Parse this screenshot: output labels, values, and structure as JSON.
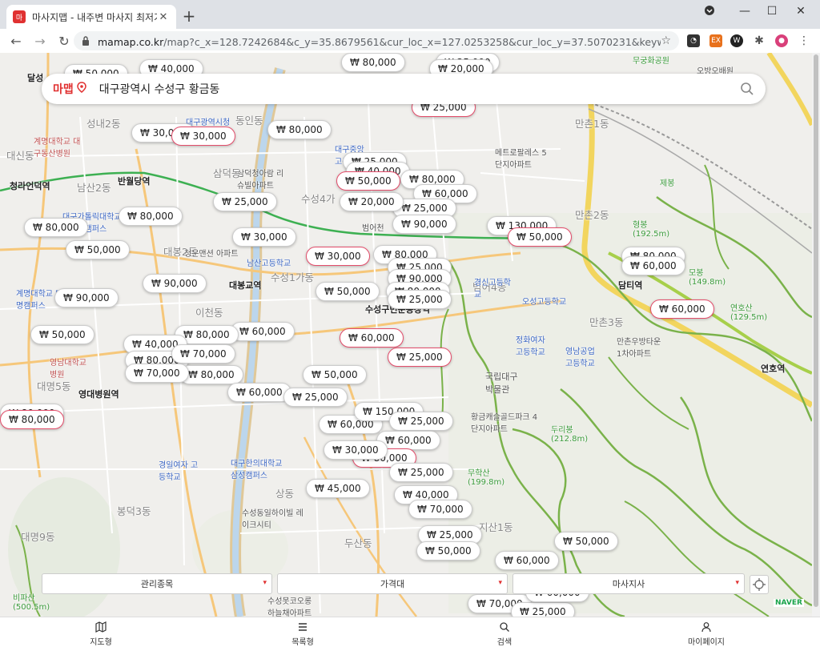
{
  "browser": {
    "tab_title": "마사지맵 - 내주변 마사지 최저가",
    "tab_favicon_label": "마",
    "new_tab": "+",
    "url_host": "mamap.co.kr",
    "url_rest": "/map?c_x=128.7242684&c_y=35.8679561&cur_loc_x=127.0253258&cur_loc_y=37.5070231&keyword=대구"
  },
  "search": {
    "brand": "마맵",
    "query": "대구광역시 수성구 황금동"
  },
  "filters": [
    {
      "label": "관리종목"
    },
    {
      "label": "가격대"
    },
    {
      "label": "마사지사"
    }
  ],
  "map_labels": {
    "naver": "NAVER",
    "places": [
      "달성",
      "계명대학교 대구동산병원",
      "대신동",
      "성내2동",
      "남산2동",
      "반월당역",
      "청라언덕역",
      "대구가톨릭대학교 유스티노캠퍼스",
      "대봉2동",
      "청운맨션 아파트",
      "대봉교역",
      "이천동",
      "계명대학교 대명캠퍼스",
      "영남대학교 병원",
      "대명5동",
      "영대병원역",
      "경일여자 고등학교",
      "봉덕3동",
      "대명9동",
      "비파산 (500.5m)",
      "동인동",
      "대구광역시청",
      "삼덕청아람 리슈빌아파트",
      "삼덕동",
      "남산고등학교",
      "수성4가",
      "수성1가동",
      "범어4동",
      "수성구민운동장역",
      "대구한의대학교 삼성캠퍼스",
      "상동",
      "수성동일하이빌 레이크시티",
      "두산동",
      "수성못코오롱 하늘채아파트",
      "만촌2동",
      "만촌1동",
      "메트로팔레스 5단지아파트",
      "형봉 (192.5m)",
      "모봉 (149.8m)",
      "연호산 (129.5m)",
      "담티역",
      "연호역",
      "만촌3동",
      "만촌우방타운 1차아파트",
      "경신고등학교",
      "정화여자 고등학교",
      "국립대구 박물관",
      "황금캐슬골드파크 4단지아파트",
      "두리봉 (212.8m)",
      "무학산 (199.8m)",
      "지산1동",
      "영남공업 고등학교",
      "오성고등학교",
      "대구중앙 고등학교",
      "무궁화공원",
      "오방오배원",
      "제봉",
      "범어천"
    ]
  },
  "price_pins": [
    "₩ 50,000",
    "₩ 40,000",
    "₩ 80,000",
    "₩ 25,000",
    "₩ 20,000",
    "₩ 25,000",
    "₩ 30,000",
    "₩ 80,000",
    "₩ 30,000",
    "₩ 25,000",
    "₩ 40,000",
    "₩ 50,000",
    "₩ 80,000",
    "₩ 60,000",
    "₩ 25,000",
    "₩ 20,000",
    "₩ 25,000",
    "₩ 90,000",
    "₩ 80,000",
    "₩ 130,000",
    "₩ 50,000",
    "₩ 80,000",
    "₩ 30,000",
    "₩ 80,000",
    "₩ 50,000",
    "₩ 30,000",
    "₩ 80,000",
    "₩ 25,000",
    "₩ 90,000",
    "₩ 90,000",
    "₩ 50,000",
    "₩ 80,000",
    "₩ 90,000",
    "₩ 60,000",
    "₩ 60,000",
    "₩ 50,000",
    "₩ 60,000",
    "₩ 80,000",
    "₩ 40,000",
    "₩ 80,000",
    "₩ 70,000",
    "₩ 80,000",
    "₩ 70,000",
    "₩ 80,000",
    "₩ 60,000",
    "₩ 25,000",
    "₩ 50,000",
    "₩ 25,000",
    "₩ 60,000",
    "₩ 150,000",
    "₩ 25,000",
    "₩ 60,000",
    "₩ 80,000",
    "₩ 25,000",
    "₩ 45,000",
    "₩ 40,000",
    "₩ 70,000",
    "₩ 25,000",
    "₩ 50,000",
    "₩ 50,000",
    "₩ 60,000",
    "₩ 70,000",
    "₩ 25,000",
    "₩ 30,000",
    "₩ 80,000",
    "₩ 60,000",
    "₩ 60,000",
    "₩ 25,000"
  ],
  "bottom_nav": [
    {
      "label": "지도형",
      "icon": "map-icon"
    },
    {
      "label": "목록형",
      "icon": "list-icon"
    },
    {
      "label": "검색",
      "icon": "search-icon"
    },
    {
      "label": "마이페이지",
      "icon": "person-icon"
    }
  ]
}
